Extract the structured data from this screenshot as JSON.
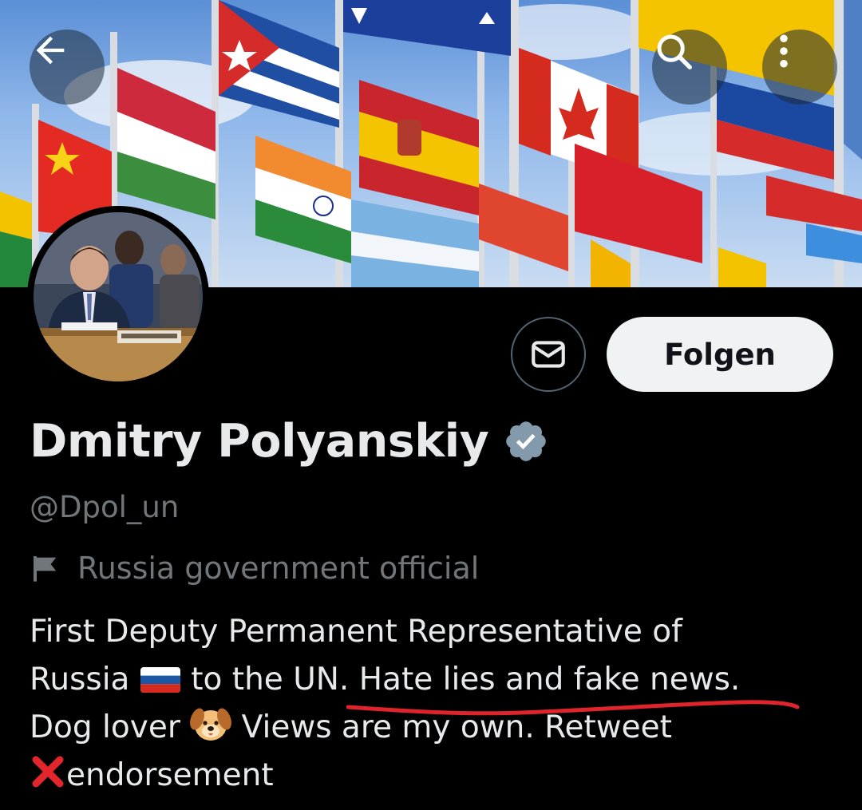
{
  "header": {
    "back_icon": "arrow-left-icon",
    "search_icon": "search-icon",
    "more_icon": "more-vertical-icon"
  },
  "actions": {
    "message_icon": "envelope-icon",
    "follow_label": "Folgen"
  },
  "profile": {
    "display_name": "Dmitry Polyanskiy",
    "verified_icon": "verified-badge-icon",
    "verified_color": "#829aab",
    "handle": "@Dpol_un",
    "affiliation_icon": "flag-icon",
    "affiliation": "Russia government official",
    "bio": {
      "line1": "First Deputy Permanent Representative of",
      "line2_part1": "Russia",
      "line2_part2": "to the UN. Hate lies and fake news.",
      "line3_part1": "Dog lover",
      "line3_part2": "Views are my own. Retweet",
      "line4": "endorsement"
    }
  },
  "colors": {
    "background": "#000000",
    "primary_text": "#e7e9ea",
    "secondary_text": "#71767b",
    "follow_bg": "#eff3f4",
    "annotation_red": "#e0242b"
  }
}
